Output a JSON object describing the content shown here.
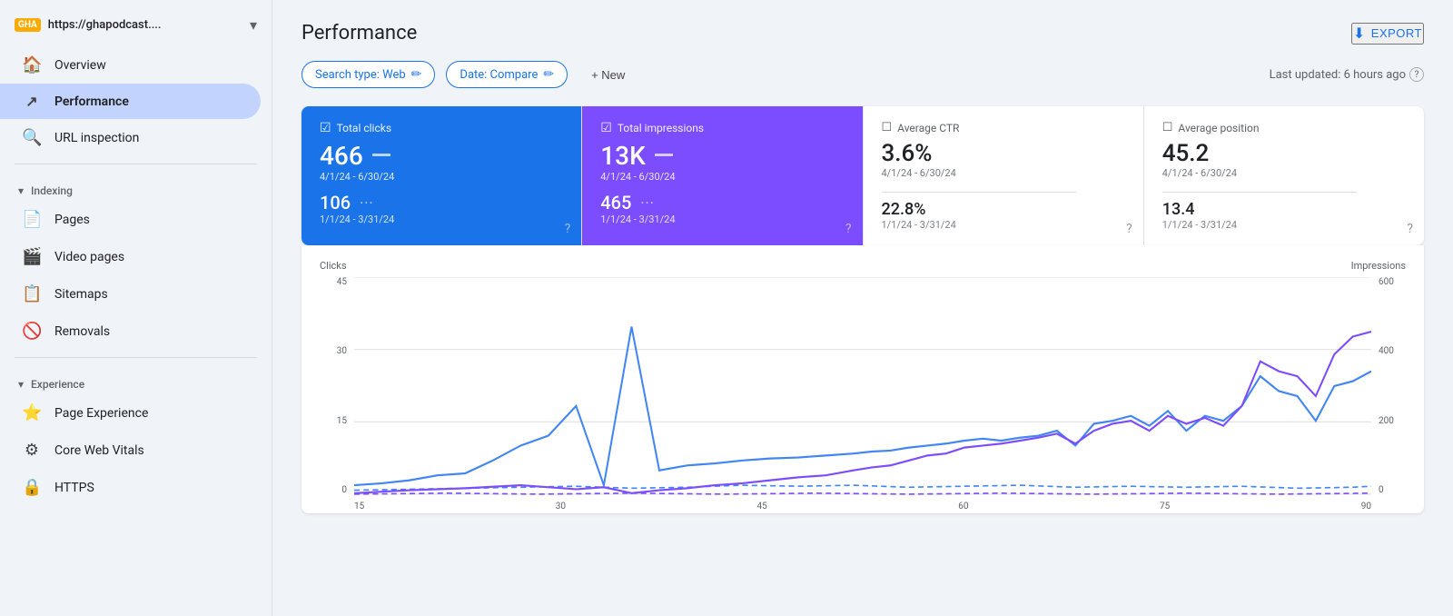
{
  "site": {
    "badge": "GHA",
    "url": "https://ghapodcast....",
    "dropdown_label": "Site selector"
  },
  "sidebar": {
    "nav_items": [
      {
        "id": "overview",
        "label": "Overview",
        "icon": "🏠",
        "active": false
      },
      {
        "id": "performance",
        "label": "Performance",
        "icon": "↗",
        "active": true
      },
      {
        "id": "url-inspection",
        "label": "URL inspection",
        "icon": "🔍",
        "active": false
      }
    ],
    "sections": [
      {
        "id": "indexing",
        "label": "Indexing",
        "items": [
          {
            "id": "pages",
            "label": "Pages",
            "icon": "📄"
          },
          {
            "id": "video-pages",
            "label": "Video pages",
            "icon": "🎬"
          },
          {
            "id": "sitemaps",
            "label": "Sitemaps",
            "icon": "📋"
          },
          {
            "id": "removals",
            "label": "Removals",
            "icon": "🚫"
          }
        ]
      },
      {
        "id": "experience",
        "label": "Experience",
        "items": [
          {
            "id": "page-experience",
            "label": "Page Experience",
            "icon": "⭐"
          },
          {
            "id": "core-web-vitals",
            "label": "Core Web Vitals",
            "icon": "⚙"
          },
          {
            "id": "https",
            "label": "HTTPS",
            "icon": "🔒"
          }
        ]
      }
    ]
  },
  "header": {
    "title": "Performance",
    "export_label": "EXPORT"
  },
  "filters": {
    "search_type_label": "Search type: Web",
    "date_label": "Date: Compare",
    "new_label": "+ New",
    "last_updated": "Last updated: 6 hours ago"
  },
  "metrics": [
    {
      "id": "total-clicks",
      "label": "Total clicks",
      "value_primary": "466",
      "date_primary": "4/1/24 - 6/30/24",
      "value_secondary": "106",
      "date_secondary": "1/1/24 - 3/31/24",
      "style": "blue"
    },
    {
      "id": "total-impressions",
      "label": "Total impressions",
      "value_primary": "13K",
      "date_primary": "4/1/24 - 6/30/24",
      "value_secondary": "465",
      "date_secondary": "1/1/24 - 3/31/24",
      "style": "purple"
    },
    {
      "id": "average-ctr",
      "label": "Average CTR",
      "value_primary": "3.6%",
      "date_primary": "4/1/24 - 6/30/24",
      "value_secondary": "22.8%",
      "date_secondary": "1/1/24 - 3/31/24",
      "style": "white"
    },
    {
      "id": "average-position",
      "label": "Average position",
      "value_primary": "45.2",
      "date_primary": "4/1/24 - 6/30/24",
      "value_secondary": "13.4",
      "date_secondary": "1/1/24 - 3/31/24",
      "style": "white"
    }
  ],
  "chart": {
    "y_axis_left_label": "Clicks",
    "y_axis_right_label": "Impressions",
    "y_left_values": [
      "45",
      "30",
      "15",
      "0"
    ],
    "y_right_values": [
      "600",
      "400",
      "200",
      "0"
    ],
    "x_labels": [
      "15",
      "30",
      "45",
      "60",
      "75",
      "90"
    ]
  }
}
